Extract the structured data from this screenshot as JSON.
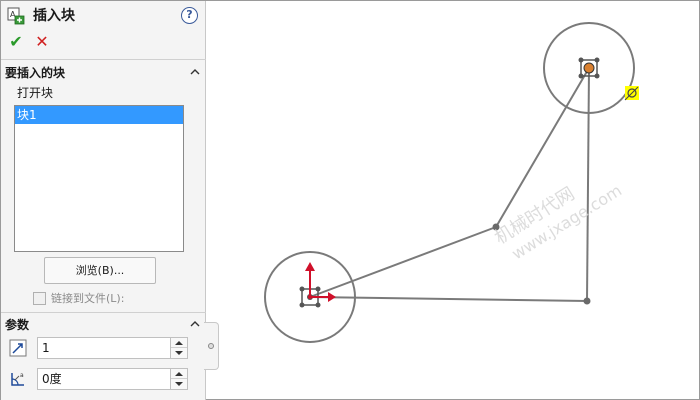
{
  "panel": {
    "title": "插入块",
    "help_label": "?",
    "ok_label": "✔",
    "cancel_label": "✕",
    "blocks_section": {
      "title": "要插入的块",
      "open_label": "打开块",
      "items": [
        "块1"
      ],
      "selected_index": 0,
      "browse_label": "浏览(B)...",
      "link_label": "链接到文件(L):",
      "link_checked": false
    },
    "params_section": {
      "title": "参数",
      "scale_value": "1",
      "angle_value": "0度"
    }
  },
  "watermark": {
    "line1": "机械时代网",
    "line2": "www.jxage.com"
  },
  "colors": {
    "selection": "#3399ff",
    "sketch_line": "#7a7a7a",
    "origin_axis": "#d0102a",
    "center_marker": "#d98030",
    "cursor_highlight": "#ffff00"
  }
}
